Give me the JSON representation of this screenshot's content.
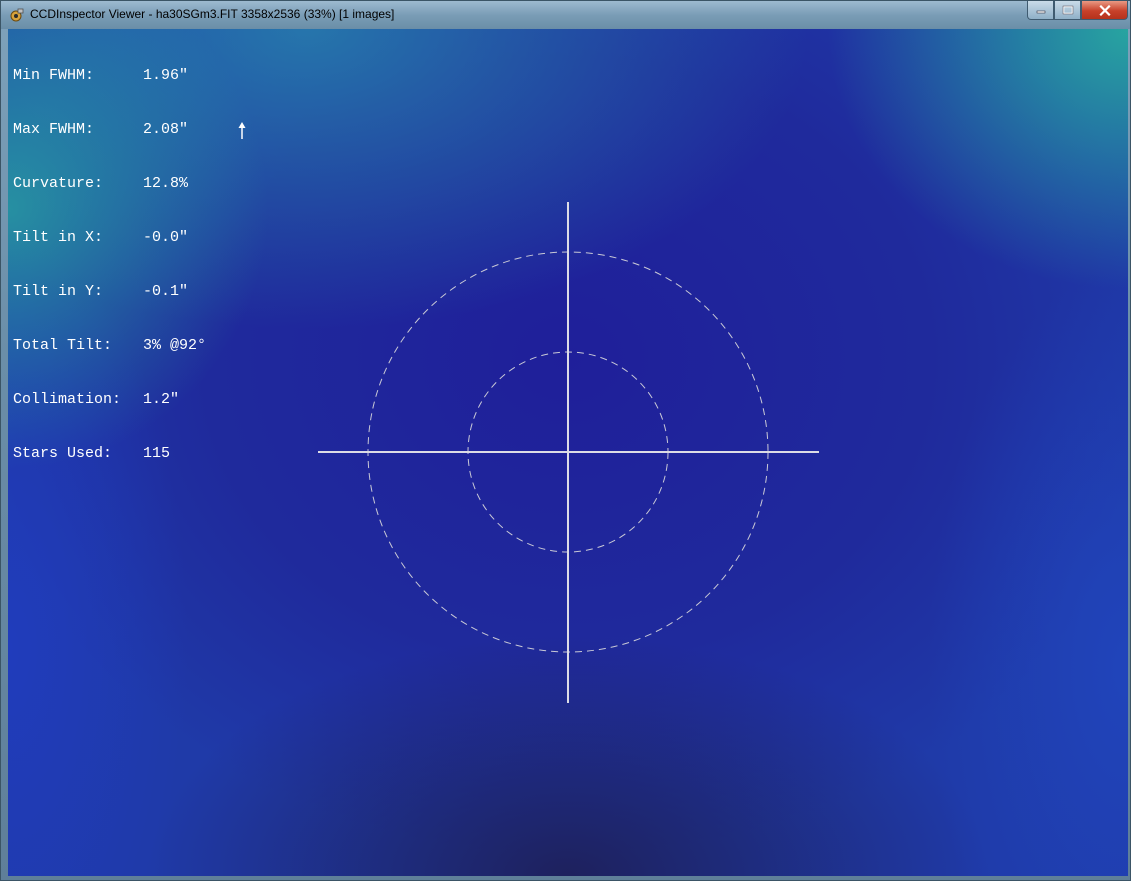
{
  "window": {
    "title": "CCDInspector Viewer - ha30SGm3.FIT 3358x2536 (33%)  [1 images]",
    "app_icon": "ccdinspector-app-icon",
    "controls": {
      "minimize_icon": "minimize-icon",
      "maximize_icon": "maximize-icon",
      "close_icon": "close-icon"
    }
  },
  "stats": [
    {
      "label": "Min FWHM:",
      "value": "1.96\""
    },
    {
      "label": "Max FWHM:",
      "value": "2.08\""
    },
    {
      "label": "Curvature:",
      "value": "12.8%"
    },
    {
      "label": "Tilt in X:",
      "value": "-0.0\""
    },
    {
      "label": "Tilt in Y:",
      "value": "-0.1\""
    },
    {
      "label": "Total Tilt:",
      "value": "3% @92°"
    },
    {
      "label": "Collimation:",
      "value": "1.2\""
    },
    {
      "label": "Stars Used:",
      "value": "115"
    }
  ],
  "tilt_indicator": {
    "icon": "tilt-direction-arrow-icon",
    "angle_deg": 92
  },
  "colors": {
    "background_center": "#1f1f9a",
    "background_teal": "#28aaa0",
    "overlay_line": "#d8d8e0",
    "text": "#ffffff"
  }
}
